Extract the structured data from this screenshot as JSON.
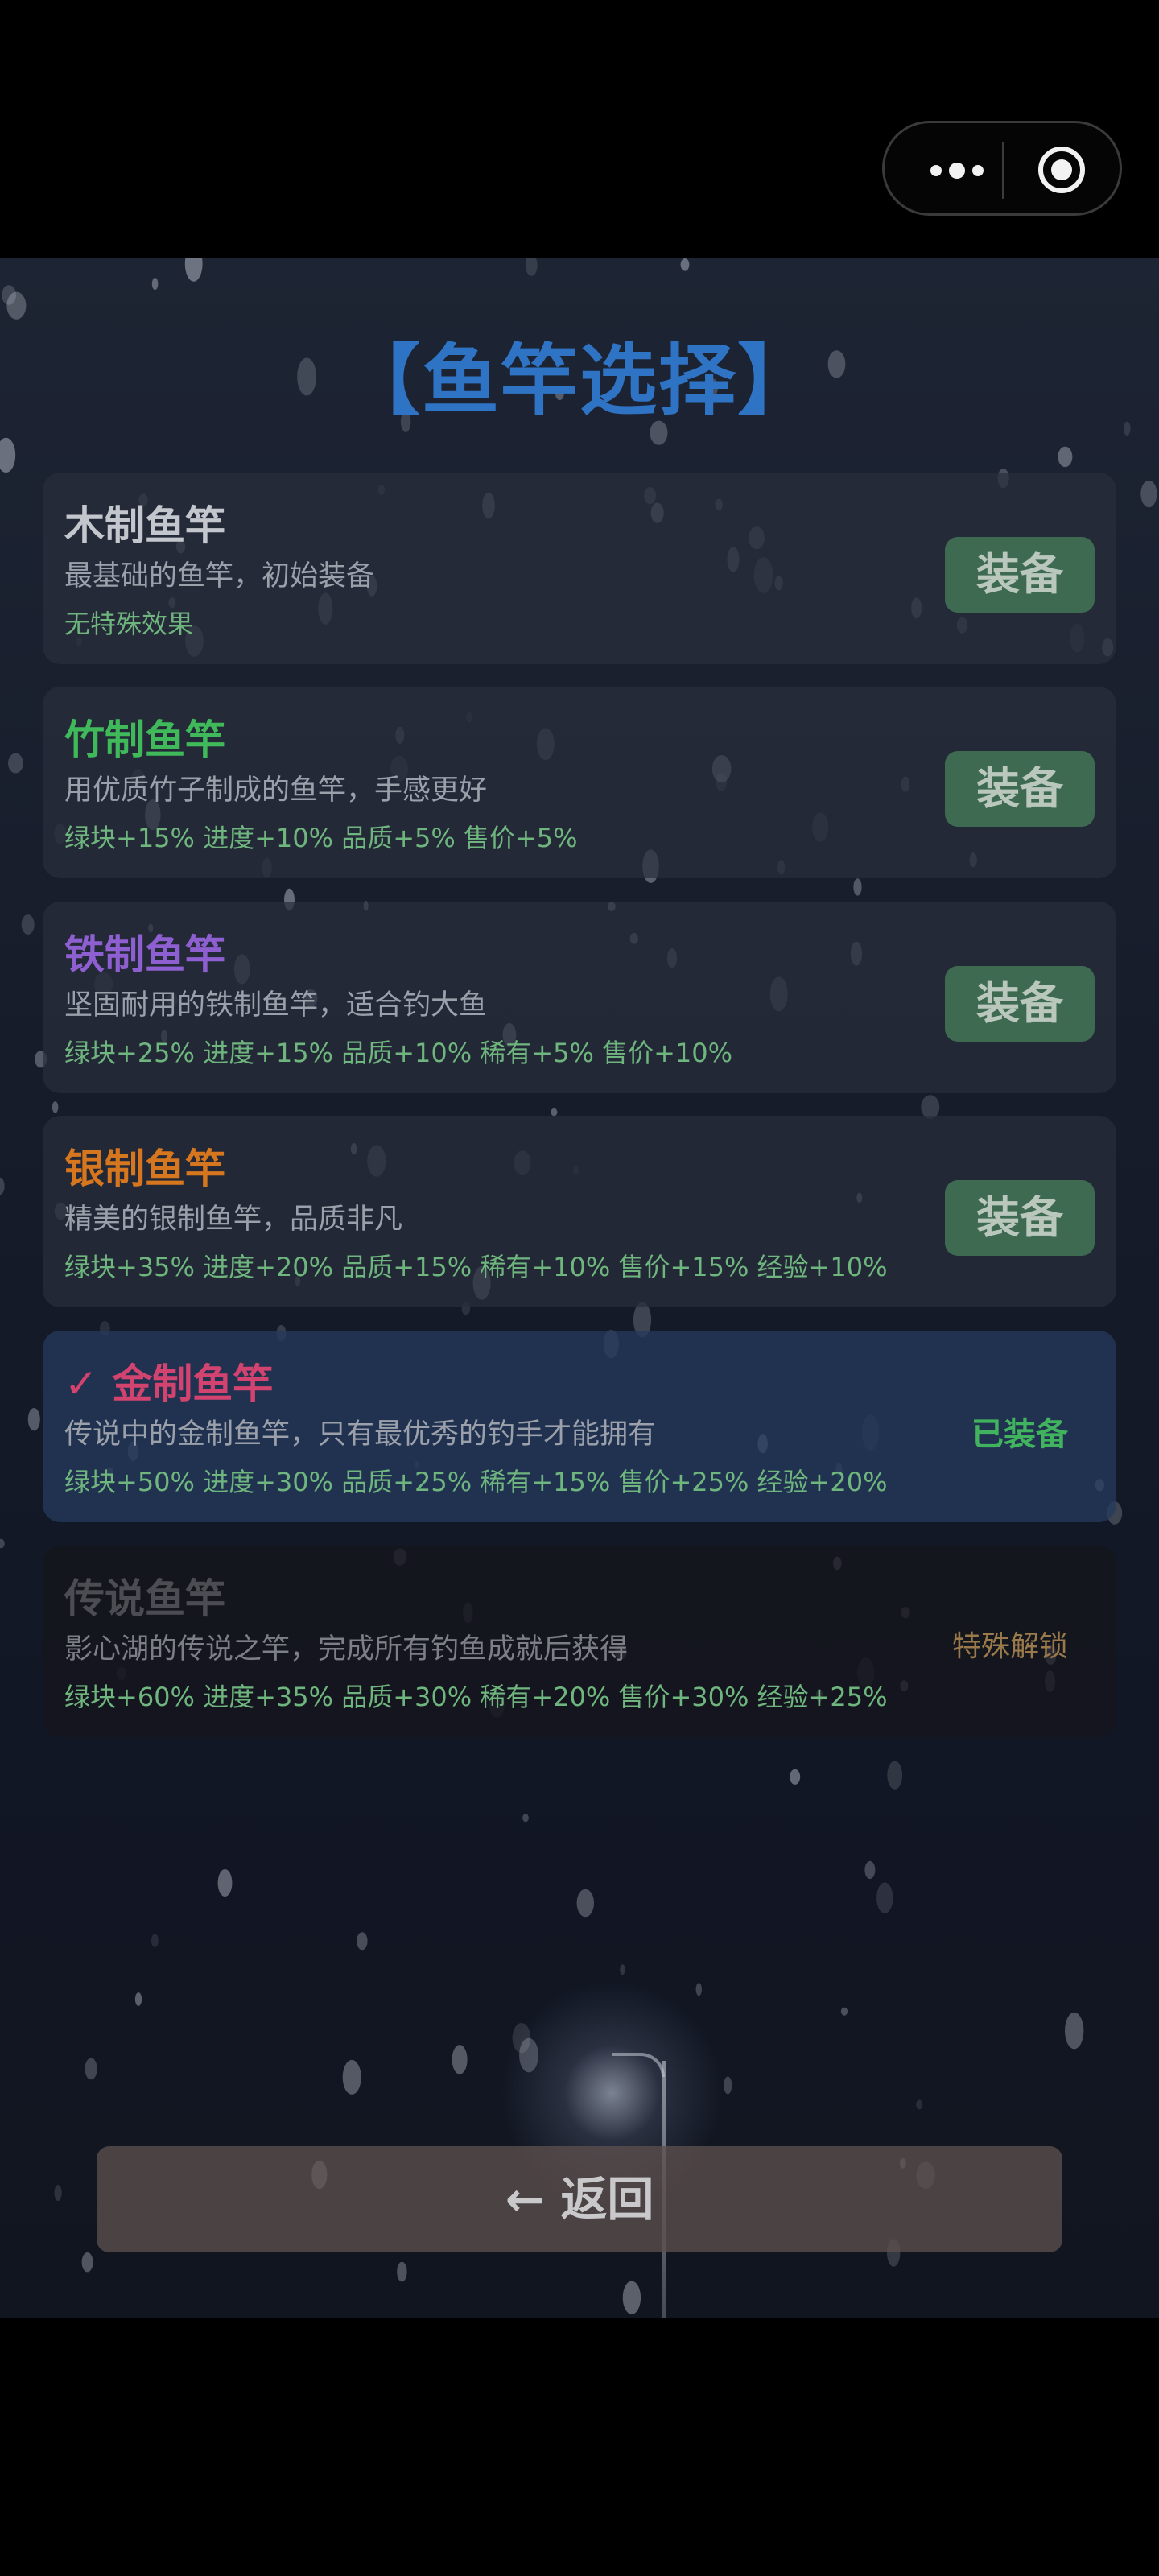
{
  "header": {
    "more_icon": "more-dots-icon",
    "close_icon": "record-target-icon"
  },
  "page": {
    "title": "【鱼竿选择】",
    "title_color": "#2f74c4"
  },
  "rods": [
    {
      "name": "木制鱼竿",
      "name_color": "#c3c6cc",
      "description": "最基础的鱼竿，初始装备",
      "effects": "无特殊效果",
      "action": "装备",
      "state": "available"
    },
    {
      "name": "竹制鱼竿",
      "name_color": "#3fb95a",
      "description": "用优质竹子制成的鱼竿，手感更好",
      "effects": "绿块+15% 进度+10% 品质+5% 售价+5%",
      "action": "装备",
      "state": "available"
    },
    {
      "name": "铁制鱼竿",
      "name_color": "#8e5fd0",
      "description": "坚固耐用的铁制鱼竿，适合钓大鱼",
      "effects": "绿块+25% 进度+15% 品质+10% 稀有+5% 售价+10%",
      "action": "装备",
      "state": "available"
    },
    {
      "name": "银制鱼竿",
      "name_color": "#d6761f",
      "description": "精美的银制鱼竿，品质非凡",
      "effects": "绿块+35% 进度+20% 品质+15% 稀有+10% 售价+15% 经验+10%",
      "action": "装备",
      "state": "available"
    },
    {
      "name": "✓ 金制鱼竿",
      "name_color": "#d2436f",
      "description": "传说中的金制鱼竿，只有最优秀的钓手才能拥有",
      "effects": "绿块+50% 进度+30% 品质+25% 稀有+15% 售价+25% 经验+20%",
      "status": "已装备",
      "status_color": "#41b25d",
      "state": "equipped"
    },
    {
      "name": "传说鱼竿",
      "name_color": "#4c4d52",
      "description": "影心湖的传说之竿，完成所有钓鱼成就后获得",
      "effects": "绿块+60% 进度+35% 品质+30% 稀有+20% 售价+30% 经验+25%",
      "status": "特殊解锁",
      "status_color": "#9a7a4a",
      "state": "locked"
    }
  ],
  "footer": {
    "back_label": "← 返回"
  },
  "colors": {
    "equip_button_bg": "#3d6a50",
    "effect_text": "#6fb57e"
  }
}
